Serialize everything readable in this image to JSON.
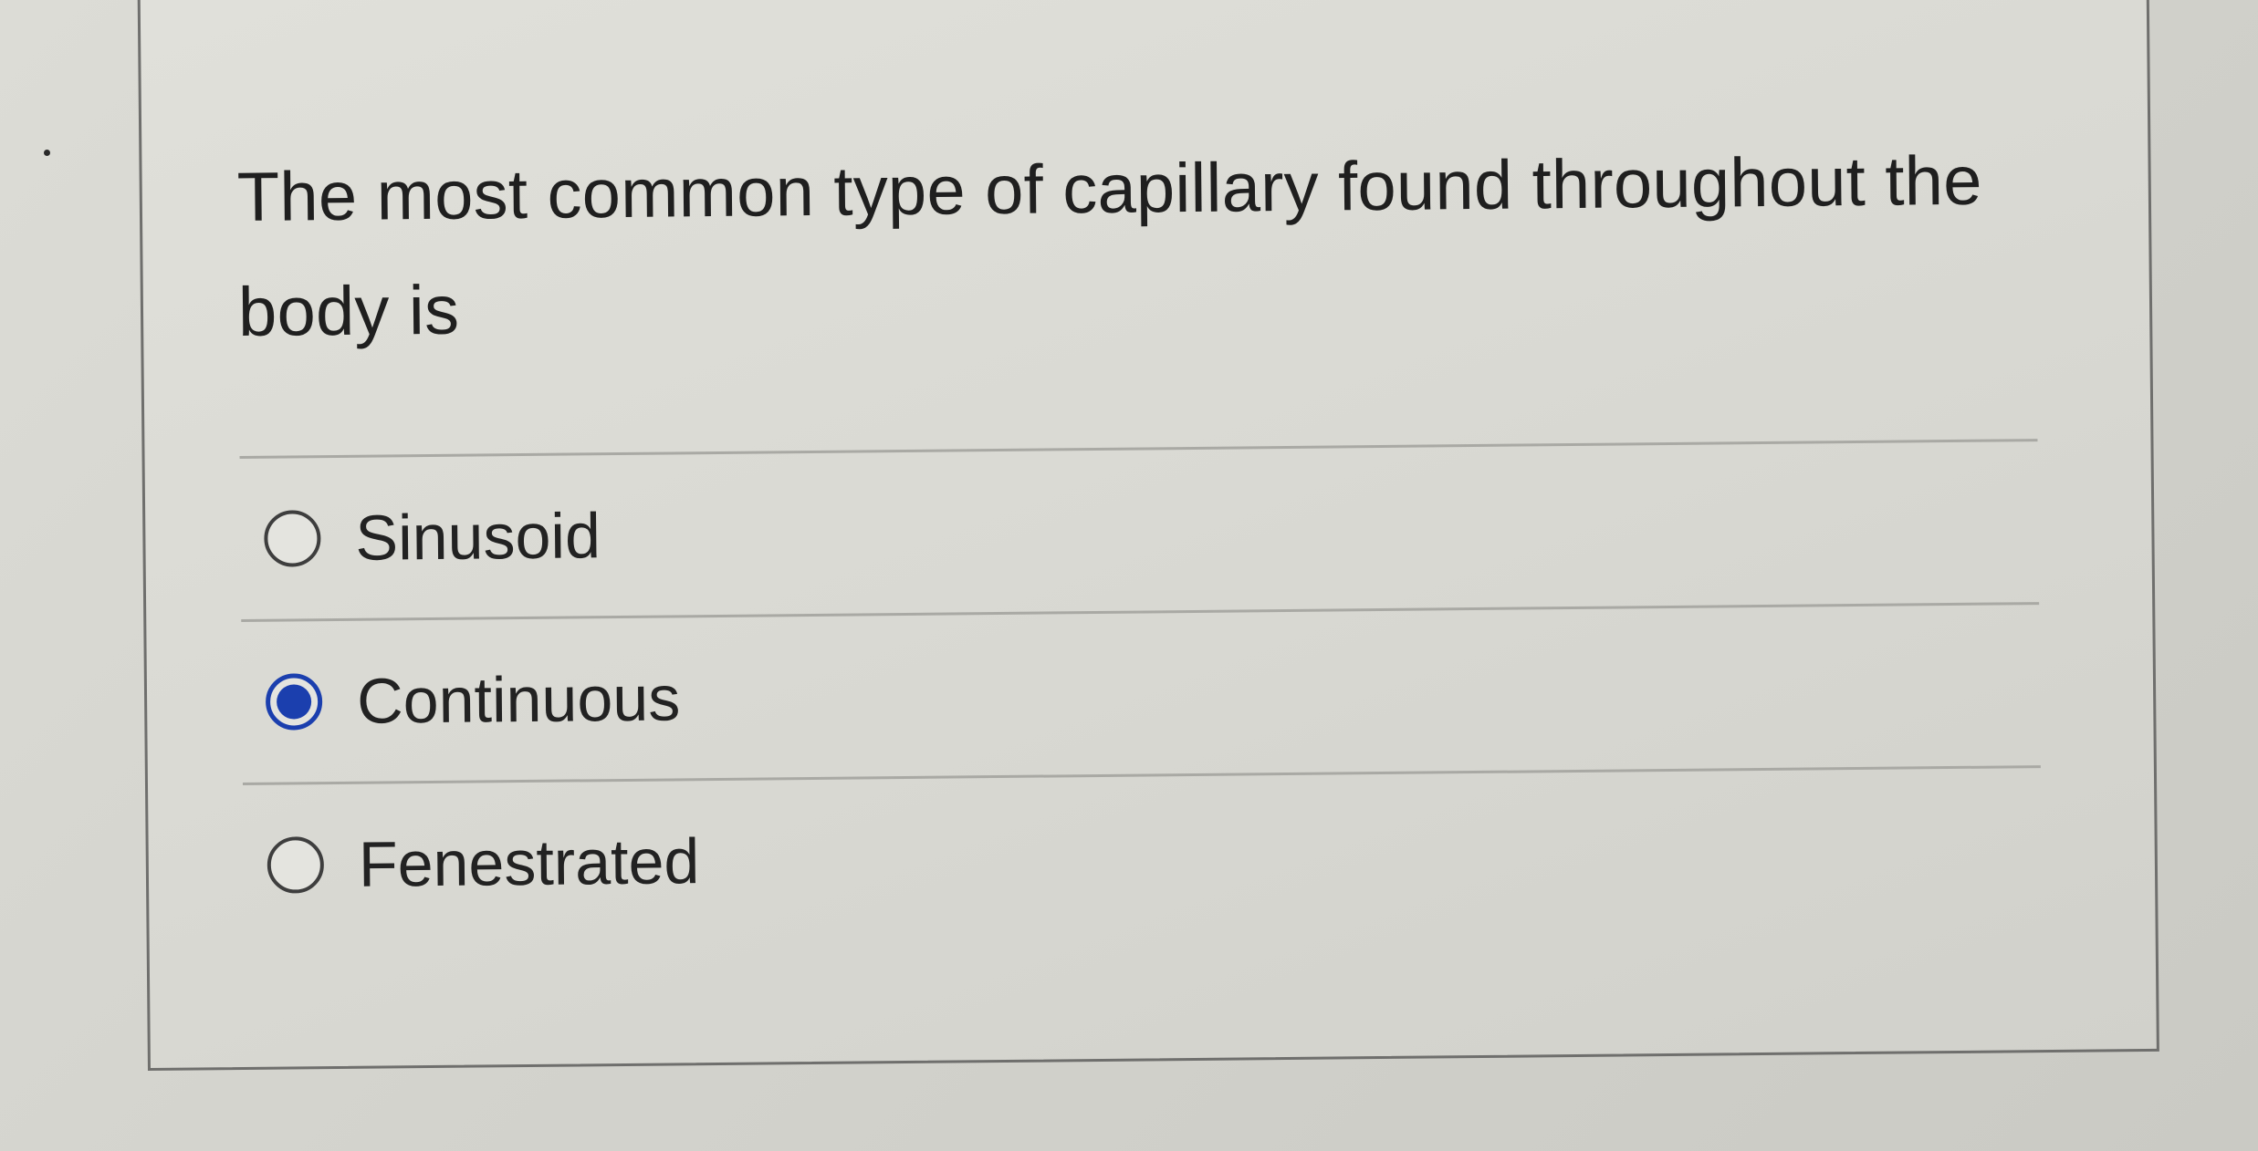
{
  "question": {
    "text": "The most common type of capillary found throughout the body is"
  },
  "options": [
    {
      "label": "Sinusoid",
      "selected": false
    },
    {
      "label": "Continuous",
      "selected": true
    },
    {
      "label": "Fenestrated",
      "selected": false
    }
  ],
  "colors": {
    "selected_accent": "#1b3fae",
    "text": "#1f1f1f",
    "card_border": "#6f6f6d"
  },
  "icons": {
    "unselected": "radio-unchecked-icon",
    "selected": "radio-checked-icon"
  }
}
